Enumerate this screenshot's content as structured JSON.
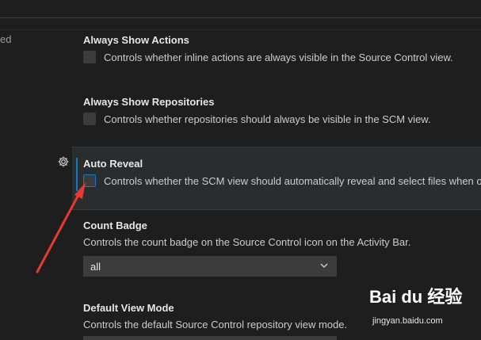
{
  "left_fragment": "ed",
  "settings": [
    {
      "title": "Always Show Actions",
      "description": "Controls whether inline actions are always visible in the Source Control view."
    },
    {
      "title": "Always Show Repositories",
      "description": "Controls whether repositories should always be visible in the SCM view."
    },
    {
      "title": "Auto Reveal",
      "description": "Controls whether the SCM view should automatically reveal and select files when op"
    },
    {
      "title": "Count Badge",
      "description": "Controls the count badge on the Source Control icon on the Activity Bar.",
      "selected_value": "all"
    },
    {
      "title": "Default View Mode",
      "description": "Controls the default Source Control repository view mode."
    }
  ],
  "icons": {
    "gear": "gear-icon",
    "chevron": "chevron-down-icon"
  },
  "colors": {
    "background": "#1e1e1e",
    "focus_accent": "#0e7aca",
    "highlight_row": "#2a2d2e",
    "annotation_arrow": "#e53935"
  },
  "watermark": {
    "logo": "Bai du 经验",
    "url": "jingyan.baidu.com"
  }
}
